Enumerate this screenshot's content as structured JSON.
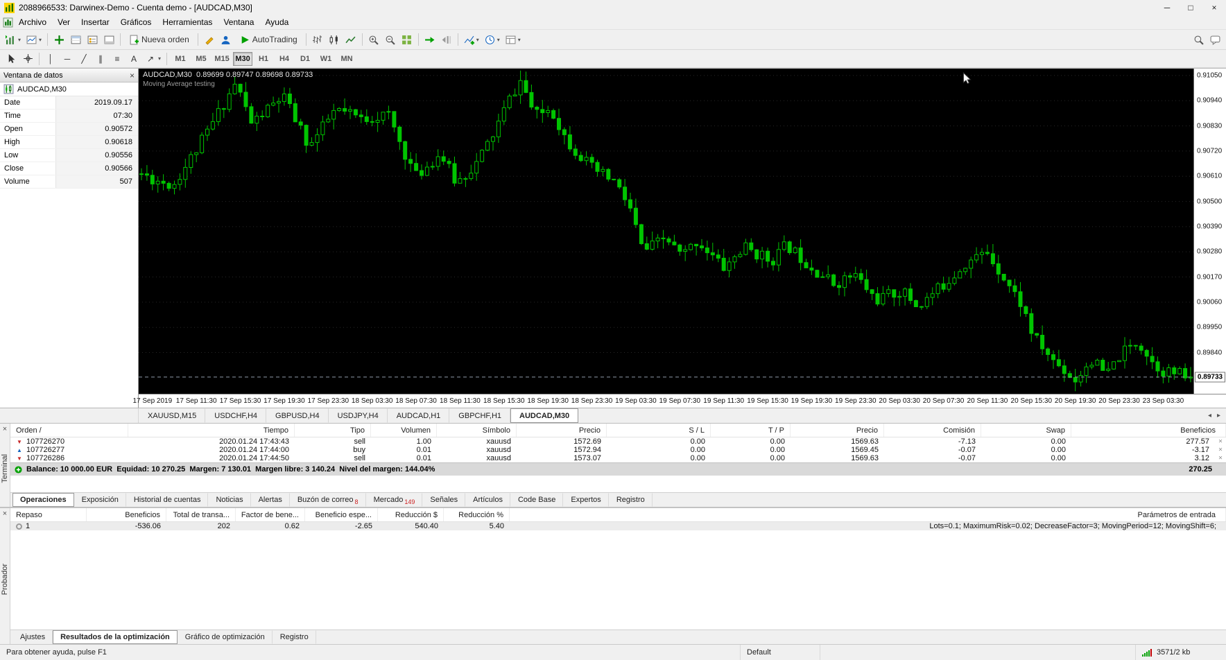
{
  "window": {
    "title": "2088966533: Darwinex-Demo - Cuenta demo - [AUDCAD,M30]"
  },
  "icons": {
    "dropdown": "▾",
    "close": "×",
    "minimize": "─",
    "maximize": "□",
    "vline": "│",
    "hline": "─",
    "trendline": "╱",
    "channel": "∥",
    "fibo": "≡",
    "text_tool": "A",
    "shapes": "↗",
    "scroll_left": "◂",
    "scroll_right": "▸"
  },
  "menu": {
    "items": [
      "Archivo",
      "Ver",
      "Insertar",
      "Gráficos",
      "Herramientas",
      "Ventana",
      "Ayuda"
    ]
  },
  "toolbar1": {
    "new_order_label": "Nueva orden",
    "autotrading_label": "AutoTrading"
  },
  "toolbar2": {
    "timeframes": [
      "M1",
      "M5",
      "M15",
      "M30",
      "H1",
      "H4",
      "D1",
      "W1",
      "MN"
    ],
    "active_timeframe": "M30"
  },
  "data_window": {
    "title": "Ventana de datos",
    "symbol": "AUDCAD,M30",
    "rows": [
      {
        "label": "Date",
        "value": "2019.09.17"
      },
      {
        "label": "Time",
        "value": "07:30"
      },
      {
        "label": "Open",
        "value": "0.90572"
      },
      {
        "label": "High",
        "value": "0.90618"
      },
      {
        "label": "Low",
        "value": "0.90556"
      },
      {
        "label": "Close",
        "value": "0.90566"
      },
      {
        "label": "Volume",
        "value": "507"
      }
    ]
  },
  "chart": {
    "header": "AUDCAD,M30  0.89699 0.89747 0.89698 0.89733",
    "ea_label": "Moving Average testing",
    "price_labels": [
      "0.91050",
      "0.90940",
      "0.90830",
      "0.90720",
      "0.90610",
      "0.90500",
      "0.90390",
      "0.90280",
      "0.90170",
      "0.90060",
      "0.89950",
      "0.89840"
    ],
    "current_price": "0.89733",
    "price_max": 0.9108,
    "price_min": 0.8966,
    "candle_color": "#00C400",
    "candle_count": 192,
    "candles_per_label": 8,
    "label_offset": 2,
    "seed": 11,
    "time_labels": [
      "17 Sep 2019",
      "17 Sep 11:30",
      "17 Sep 15:30",
      "17 Sep 19:30",
      "17 Sep 23:30",
      "18 Sep 03:30",
      "18 Sep 07:30",
      "18 Sep 11:30",
      "18 Sep 15:30",
      "18 Sep 19:30",
      "18 Sep 23:30",
      "19 Sep 03:30",
      "19 Sep 07:30",
      "19 Sep 11:30",
      "19 Sep 15:30",
      "19 Sep 19:30",
      "19 Sep 23:30",
      "20 Sep 03:30",
      "20 Sep 07:30",
      "20 Sep 11:30",
      "20 Sep 15:30",
      "20 Sep 19:30",
      "20 Sep 23:30",
      "23 Sep 03:30"
    ],
    "anchors": [
      [
        0,
        0.9062
      ],
      [
        0.01,
        0.906
      ],
      [
        0.03,
        0.9057
      ],
      [
        0.06,
        0.9078
      ],
      [
        0.09,
        0.9102
      ],
      [
        0.105,
        0.9084
      ],
      [
        0.135,
        0.9096
      ],
      [
        0.16,
        0.9074
      ],
      [
        0.185,
        0.909
      ],
      [
        0.21,
        0.9086
      ],
      [
        0.235,
        0.9088
      ],
      [
        0.25,
        0.9072
      ],
      [
        0.262,
        0.9061
      ],
      [
        0.285,
        0.9071
      ],
      [
        0.3,
        0.9058
      ],
      [
        0.32,
        0.9067
      ],
      [
        0.335,
        0.9079
      ],
      [
        0.35,
        0.9094
      ],
      [
        0.362,
        0.9103
      ],
      [
        0.375,
        0.9087
      ],
      [
        0.39,
        0.9091
      ],
      [
        0.405,
        0.9077
      ],
      [
        0.43,
        0.9064
      ],
      [
        0.45,
        0.9059
      ],
      [
        0.465,
        0.9048
      ],
      [
        0.478,
        0.9028
      ],
      [
        0.5,
        0.9034
      ],
      [
        0.515,
        0.9026
      ],
      [
        0.53,
        0.9033
      ],
      [
        0.555,
        0.9021
      ],
      [
        0.575,
        0.903
      ],
      [
        0.6,
        0.9024
      ],
      [
        0.615,
        0.9031
      ],
      [
        0.64,
        0.9021
      ],
      [
        0.66,
        0.9014
      ],
      [
        0.68,
        0.9018
      ],
      [
        0.7,
        0.9007
      ],
      [
        0.725,
        0.9011
      ],
      [
        0.74,
        0.9004
      ],
      [
        0.765,
        0.9014
      ],
      [
        0.785,
        0.9023
      ],
      [
        0.806,
        0.9028
      ],
      [
        0.822,
        0.9017
      ],
      [
        0.84,
        0.9004
      ],
      [
        0.85,
        0.8991
      ],
      [
        0.868,
        0.8981
      ],
      [
        0.89,
        0.8972
      ],
      [
        0.905,
        0.8981
      ],
      [
        0.92,
        0.8974
      ],
      [
        0.933,
        0.8983
      ],
      [
        0.95,
        0.8989
      ],
      [
        0.965,
        0.8979
      ],
      [
        0.975,
        0.8976
      ],
      [
        1,
        0.89733
      ]
    ]
  },
  "chart_tabs": {
    "tabs": [
      "XAUUSD,M15",
      "USDCHF,H4",
      "GBPUSD,H4",
      "USDJPY,H4",
      "AUDCAD,H1",
      "GBPCHF,H1",
      "AUDCAD,M30"
    ],
    "active": "AUDCAD,M30"
  },
  "terminal": {
    "vertical_label": "Terminal",
    "columns": [
      "Orden  /",
      "Tiempo",
      "Tipo",
      "Volumen",
      "Símbolo",
      "Precio",
      "S / L",
      "T / P",
      "Precio",
      "Comisión",
      "Swap",
      "Beneficios"
    ],
    "orders": [
      {
        "id": "107726270",
        "time": "2020.01.24 17:43:43",
        "type": "sell",
        "volume": "1.00",
        "symbol": "xauusd",
        "price": "1572.69",
        "sl": "0.00",
        "tp": "0.00",
        "price2": "1569.63",
        "commission": "-7.13",
        "swap": "0.00",
        "profit": "277.57"
      },
      {
        "id": "107726277",
        "time": "2020.01.24 17:44:00",
        "type": "buy",
        "volume": "0.01",
        "symbol": "xauusd",
        "price": "1572.94",
        "sl": "0.00",
        "tp": "0.00",
        "price2": "1569.45",
        "commission": "-0.07",
        "swap": "0.00",
        "profit": "-3.17"
      },
      {
        "id": "107726286",
        "time": "2020.01.24 17:44:50",
        "type": "sell",
        "volume": "0.01",
        "symbol": "xauusd",
        "price": "1573.07",
        "sl": "0.00",
        "tp": "0.00",
        "price2": "1569.63",
        "commission": "-0.07",
        "swap": "0.00",
        "profit": "3.12"
      }
    ],
    "balance_line": "Balance: 10 000.00 EUR  Equidad: 10 270.25  Margen: 7 130.01  Margen libre: 3 140.24  Nivel del margen: 144.04%",
    "balance_total": "270.25",
    "tabs": [
      {
        "label": "Operaciones",
        "badge": ""
      },
      {
        "label": "Exposición",
        "badge": ""
      },
      {
        "label": "Historial de cuentas",
        "badge": ""
      },
      {
        "label": "Noticias",
        "badge": ""
      },
      {
        "label": "Alertas",
        "badge": ""
      },
      {
        "label": "Buzón de correo",
        "badge": "8"
      },
      {
        "label": "Mercado",
        "badge": "149"
      },
      {
        "label": "Señales",
        "badge": ""
      },
      {
        "label": "Artículos",
        "badge": ""
      },
      {
        "label": "Code Base",
        "badge": ""
      },
      {
        "label": "Expertos",
        "badge": ""
      },
      {
        "label": "Registro",
        "badge": ""
      }
    ],
    "active_tab": "Operaciones"
  },
  "tester": {
    "vertical_label": "Probador",
    "columns": [
      "Repaso",
      "Beneficios",
      "Total de transa...",
      "Factor de bene...",
      "Beneficio espe...",
      "Reducción $",
      "Reducción %"
    ],
    "params_column": "Parámetros de entrada",
    "rows": [
      {
        "pass": "1",
        "profit": "-536.06",
        "trades": "202",
        "pf": "0.62",
        "expected": "-2.65",
        "dd_abs": "540.40",
        "dd_pct": "5.40",
        "params": "Lots=0.1; MaximumRisk=0.02; DecreaseFactor=3; MovingPeriod=12; MovingShift=6;"
      }
    ],
    "tabs": [
      "Ajustes",
      "Resultados de la optimización",
      "Gráfico de optimización",
      "Registro"
    ],
    "active_tab": "Resultados de la optimización"
  },
  "status_bar": {
    "help": "Para obtener ayuda, pulse F1",
    "profile": "Default",
    "connection": "3571/2 kb"
  }
}
